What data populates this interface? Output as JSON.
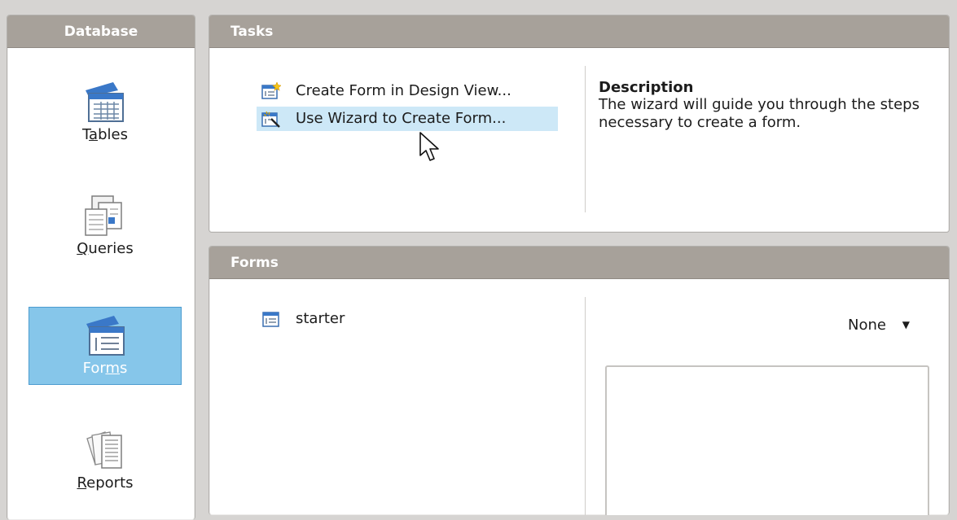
{
  "database_panel": {
    "title": "Database",
    "items": [
      {
        "label_pre": "T",
        "label_ul": "a",
        "label_post": "bles",
        "icon": "tables-icon"
      },
      {
        "label_pre": "",
        "label_ul": "Q",
        "label_post": "ueries",
        "icon": "queries-icon"
      },
      {
        "label_pre": "For",
        "label_ul": "m",
        "label_post": "s",
        "icon": "forms-icon",
        "selected": true
      },
      {
        "label_pre": "",
        "label_ul": "R",
        "label_post": "eports",
        "icon": "reports-icon"
      }
    ]
  },
  "tasks_panel": {
    "title": "Tasks",
    "tasks": [
      {
        "label": "Create Form in Design View...",
        "icon": "form-design-icon"
      },
      {
        "label": "Use Wizard to Create Form...",
        "icon": "form-wizard-icon",
        "hovered": true
      }
    ],
    "description": {
      "title": "Description",
      "text": "The wizard will guide you through the steps necessary to create a form."
    }
  },
  "forms_panel": {
    "title": "Forms",
    "items": [
      {
        "label": "starter",
        "icon": "form-document-icon"
      }
    ],
    "preview_dropdown": {
      "value": "None"
    }
  },
  "colors": {
    "header_bg": "#a7a19a",
    "selection_bg": "#86c6ea",
    "hover_bg": "#cde8f7",
    "window_bg": "#d6d4d2"
  }
}
